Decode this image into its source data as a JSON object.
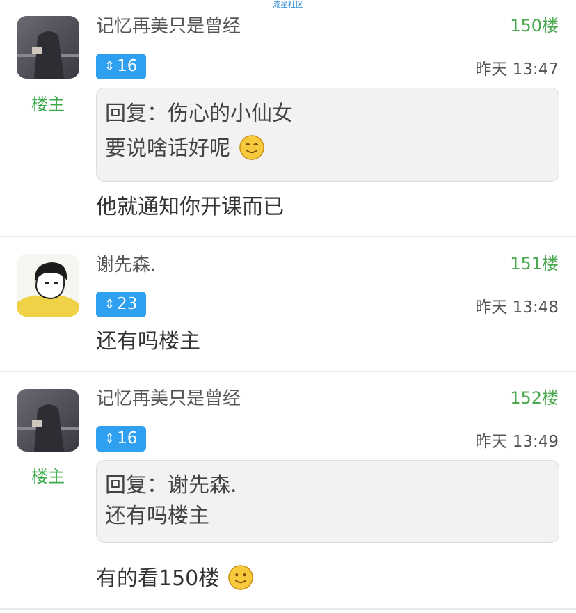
{
  "watermark": "流星社区",
  "posts": [
    {
      "username": "记忆再美只是曾经",
      "floor": "150楼",
      "level": "16",
      "time": "昨天 13:47",
      "owner_tag": "楼主",
      "quote": {
        "line1": "回复：伤心的小仙女",
        "line2": "要说啥话好呢"
      },
      "content": "他就通知你开课而已"
    },
    {
      "username": "谢先森.",
      "floor": "151楼",
      "level": "23",
      "time": "昨天 13:48",
      "content": "还有吗楼主"
    },
    {
      "username": "记忆再美只是曾经",
      "floor": "152楼",
      "level": "16",
      "time": "昨天 13:49",
      "owner_tag": "楼主",
      "quote": {
        "line1": "回复：谢先森.",
        "line2": "还有吗楼主"
      },
      "content": "有的看150楼"
    }
  ],
  "icons": {
    "level": "level-arrow-icon",
    "emoji": "smiley-emoji-icon"
  },
  "colors": {
    "accent_blue": "#2f9ff0",
    "floor_green": "#4aa84f",
    "owner_green": "#3daa4c"
  }
}
